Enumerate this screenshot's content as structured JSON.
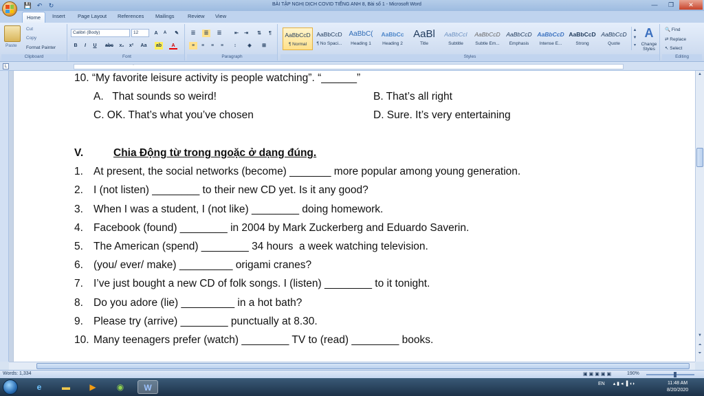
{
  "window": {
    "title": "BÀI TẬP NGHỊ DỊCH COVID TIẾNG ANH 8, Bài số 1 - Microsoft Word",
    "minimize": "—",
    "restore": "❐",
    "close": "✕"
  },
  "tabs": [
    "Home",
    "Insert",
    "Page Layout",
    "References",
    "Mailings",
    "Review",
    "View"
  ],
  "ribbon": {
    "clipboard": {
      "paste": "Paste",
      "cut": "Cut",
      "copy": "Copy",
      "format_painter": "Format Painter",
      "label": "Clipboard"
    },
    "font": {
      "name": "Calibri (Body)",
      "size": "12",
      "label": "Font"
    },
    "paragraph": {
      "label": "Paragraph"
    },
    "styles": {
      "label": "Styles",
      "items": [
        {
          "preview": "AaBbCcD",
          "name": "¶ Normal"
        },
        {
          "preview": "AaBbCcD",
          "name": "¶ No Spaci..."
        },
        {
          "preview": "AaBbC(",
          "name": "Heading 1"
        },
        {
          "preview": "AaBbCc",
          "name": "Heading 2"
        },
        {
          "preview": "AaBl",
          "name": "Title"
        },
        {
          "preview": "AaBbCcI",
          "name": "Subtitle"
        },
        {
          "preview": "AaBbCcD",
          "name": "Subtle Em..."
        },
        {
          "preview": "AaBbCcD",
          "name": "Emphasis"
        },
        {
          "preview": "AaBbCcD",
          "name": "Intense E..."
        },
        {
          "preview": "AaBbCcD",
          "name": "Strong"
        },
        {
          "preview": "AaBbCcD",
          "name": "Quote"
        }
      ],
      "change_styles": "Change Styles"
    },
    "editing": {
      "find": "Find",
      "replace": "Replace",
      "select": "Select",
      "label": "Editing"
    }
  },
  "document": {
    "q10_prev": "10. “My favorite leisure activity is people watching”. “______”",
    "options": {
      "a": "A.   That sounds so weird!",
      "b": "B. That’s all right",
      "c": "C. OK. That’s what you’ve chosen",
      "d": "D. Sure. It’s very entertaining"
    },
    "section_number": "V.",
    "section_title": "Chia Động từ trong ngoặc ở dạng đúng.",
    "items": [
      {
        "n": "1.",
        "text": "At present, the social networks (become) _______ more popular among young generation."
      },
      {
        "n": "2.",
        "text": "I (not listen) ________ to their new CD yet. Is it any good?"
      },
      {
        "n": "3.",
        "text": "When I was a student, I (not like) ________ doing homework."
      },
      {
        "n": "4.",
        "text": "Facebook (found) ________ in 2004 by Mark Zuckerberg and Eduardo Saverin."
      },
      {
        "n": "5.",
        "text": "The American (spend) ________ 34 hours  a week watching television."
      },
      {
        "n": "6.",
        "text": "(you/ ever/ make) _________ origami cranes?"
      },
      {
        "n": "7.",
        "text": "I’ve just bought a new CD of folk songs. I (listen) ________ to it tonight."
      },
      {
        "n": "8.",
        "text": "Do you adore (lie) _________ in a hot bath?"
      },
      {
        "n": "9.",
        "text": "Please try (arrive) ________ punctually at 8.30."
      },
      {
        "n": "10.",
        "text": "Many teenagers prefer (watch) ________ TV to (read) ________ books."
      }
    ]
  },
  "status": {
    "words": "Words: 1,334",
    "zoom": "190%"
  },
  "taskbar": {
    "lang": "EN",
    "time": "11:48 AM",
    "date": "8/20/2020"
  }
}
